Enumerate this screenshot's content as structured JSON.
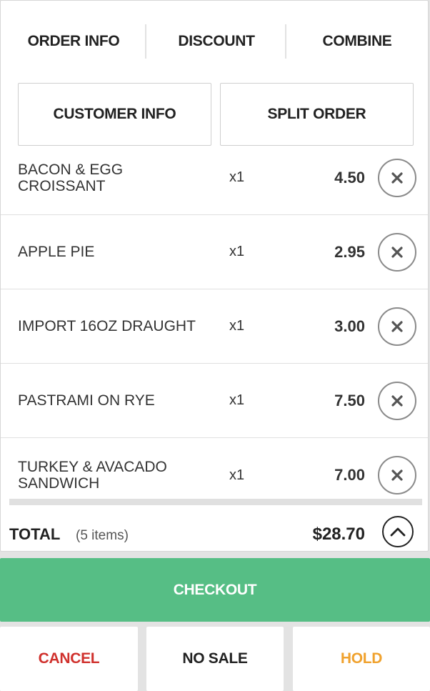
{
  "tabs": [
    {
      "label": "ORDER INFO"
    },
    {
      "label": "DISCOUNT"
    },
    {
      "label": "COMBINE"
    }
  ],
  "actions": {
    "customer_info": "CUSTOMER INFO",
    "split_order": "SPLIT ORDER"
  },
  "items": [
    {
      "name": "BACON & EGG CROISSANT",
      "qty": "x1",
      "price": "4.50"
    },
    {
      "name": "APPLE PIE",
      "qty": "x1",
      "price": "2.95"
    },
    {
      "name": "IMPORT 16OZ DRAUGHT",
      "qty": "x1",
      "price": "3.00"
    },
    {
      "name": "PASTRAMI ON RYE",
      "qty": "x1",
      "price": "7.50"
    },
    {
      "name": "TURKEY & AVACADO SANDWICH",
      "qty": "x1",
      "price": "7.00"
    }
  ],
  "total": {
    "label": "TOTAL",
    "count": "(5 items)",
    "amount": "$28.70"
  },
  "checkout_label": "CHECKOUT",
  "bottom": {
    "cancel": "CANCEL",
    "no_sale": "NO SALE",
    "hold": "HOLD"
  },
  "colors": {
    "checkout_bg": "#56be85",
    "cancel_text": "#d0312d",
    "hold_text": "#f0a22e"
  },
  "icons": {
    "remove": "close-x-circle-icon",
    "expand": "chevron-up-circle-icon"
  }
}
